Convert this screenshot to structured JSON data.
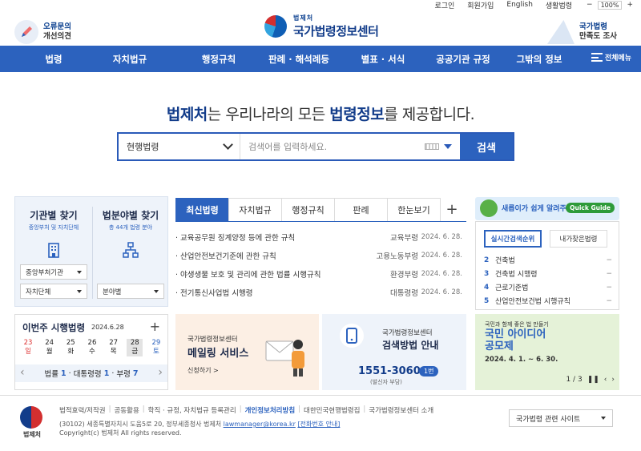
{
  "util": {
    "login": "로그인",
    "join": "회원가입",
    "english": "English",
    "life": "생활법령",
    "zoom": "100%",
    "minus": "−",
    "plus": "+"
  },
  "header": {
    "error_report": {
      "line1": "오류문의",
      "line2": "개선의견"
    },
    "logo": {
      "small": "법제처",
      "big": "국가법령정보센터"
    },
    "survey": {
      "line1": "국가법령",
      "line2": "만족도 조사"
    }
  },
  "gnb": {
    "items": [
      "법령",
      "자치법규",
      "행정규칙",
      "판례 · 해석례등",
      "별표 · 서식",
      "공공기관 규정",
      "그밖의 정보"
    ],
    "all": "전체메뉴"
  },
  "headline": {
    "b1": "법제처",
    "t1": "는 우리나라의 모든 ",
    "b2": "법령정보",
    "t2": "를 제공합니다."
  },
  "search": {
    "select": "현행법령",
    "placeholder": "검색어를 입력하세요.",
    "button": "검색"
  },
  "finder": {
    "org": {
      "title": "기관별 찾기",
      "sub": "중앙부처 및 자치단체",
      "sel1": "중앙부처기관",
      "sel2": "자치단체"
    },
    "field": {
      "title": "법분야별 찾기",
      "sub": "총 44개 법령 분야",
      "sel1": "분야별"
    }
  },
  "weekly": {
    "title": "이번주 시행법령",
    "date": "2024.6.28",
    "plus": "+",
    "days": [
      {
        "d": "23",
        "w": "일"
      },
      {
        "d": "24",
        "w": "월"
      },
      {
        "d": "25",
        "w": "화"
      },
      {
        "d": "26",
        "w": "수"
      },
      {
        "d": "27",
        "w": "목"
      },
      {
        "d": "28",
        "w": "금"
      },
      {
        "d": "29",
        "w": "토"
      }
    ],
    "summary": {
      "l1": "법률",
      "n1": "1",
      "l2": "대통령령",
      "n2": "1",
      "l3": "부령",
      "n3": "7"
    }
  },
  "tabs": [
    "최신법령",
    "자치법규",
    "행정규칙",
    "판례",
    "한눈보기"
  ],
  "news": [
    {
      "title": "· 교육공무원 징계양정 등에 관한 규칙",
      "dept": "교육부령",
      "date": "2024. 6. 28."
    },
    {
      "title": "· 산업안전보건기준에 관한 규칙",
      "dept": "고용노동부령",
      "date": "2024. 6. 28."
    },
    {
      "title": "· 야생생물 보호 및 관리에 관한 법률 시행규칙",
      "dept": "환경부령",
      "date": "2024. 6. 28."
    },
    {
      "title": "· 전기통신사업법 시행령",
      "dept": "대통령령",
      "date": "2024. 6. 28."
    }
  ],
  "banner_mail": {
    "l1": "국가법령정보센터",
    "l2": "메일링 서비스",
    "l3": "신청하기 >"
  },
  "banner_search": {
    "l1": "국가법령정보센터",
    "l2": "검색방법 안내",
    "phone": "1551-3060",
    "pill": "1번",
    "note": "(발신자 부담)"
  },
  "quick": {
    "text": "새롭이가 쉽게 알려주는 국법",
    "btn": "Quick Guide"
  },
  "rank": {
    "tab1": "실시간검색순위",
    "tab2": "내가찾은법령",
    "items": [
      {
        "n": "2",
        "t": "건축법",
        "m": "−"
      },
      {
        "n": "3",
        "t": "건축법 시행령",
        "m": "−"
      },
      {
        "n": "4",
        "t": "근로기준법",
        "m": "−"
      },
      {
        "n": "5",
        "t": "산업안전보건법 시행규칙",
        "m": "−"
      }
    ]
  },
  "idea": {
    "l1": "국민과 함께 좋은 법 만들기",
    "l2a": "국민 아이디어",
    "l2b": "공모제",
    "l3": "2024. 4. 1. ~ 6. 30.",
    "l4": "",
    "page": "1 / 3"
  },
  "footer": {
    "logo": "법제처",
    "links": [
      "법적효력/저작권",
      "공동활용",
      "학직 · 규정, 자치법규 등록관리",
      "개인정보처리방침",
      "대한민국현행법령집",
      "국가법령정보센터 소개"
    ],
    "addr1": "(30102) 세종특별자치시 도움5로 20, 정부세종청사 법제처 ",
    "email": "lawmanager@korea.kr",
    "phoneinfo": "[전화번호 안내]",
    "copy": "Copyright(c) 법제처 All rights reserved.",
    "related": "국가법령 관련 사이트"
  }
}
